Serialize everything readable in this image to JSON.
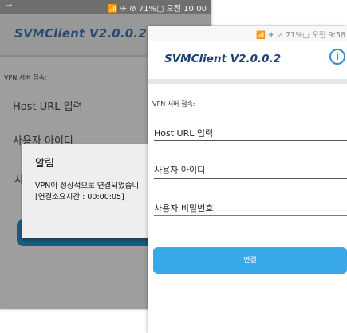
{
  "back_screen": {
    "status_bar": {
      "left_icon": "signal-icon",
      "right_text": "📶 ✈ ⊘ 71%▢ 오전 10:00"
    },
    "app_title": "SVMClient V2.0.0.2",
    "section_label": "VPN 서버 접속:",
    "host_label": "Host URL 입력",
    "user_label": "사용자 아이디",
    "pw_label_partial": "사",
    "dialog": {
      "title": "알림",
      "message_line1": "VPN이 정상적으로 연결되었습니",
      "message_line2": "[연결소요시간 : 00:00:05]"
    }
  },
  "front_screen": {
    "status_bar": {
      "right_text": "📶 ✈ ⊘ 71%▢ 오전 9:58"
    },
    "app_title": "SVMClient V2.0.0.2",
    "info_icon": "i",
    "section_label": "VPN 서버 접속:",
    "host_placeholder": "Host URL 입력",
    "user_placeholder": "사용자 아이디",
    "pw_placeholder": "사용자 비밀번호",
    "connect_label": "연결"
  },
  "colors": {
    "accent": "#38a8ea",
    "title": "#1f3f77",
    "dim_overlay": "#9e9e9e"
  }
}
